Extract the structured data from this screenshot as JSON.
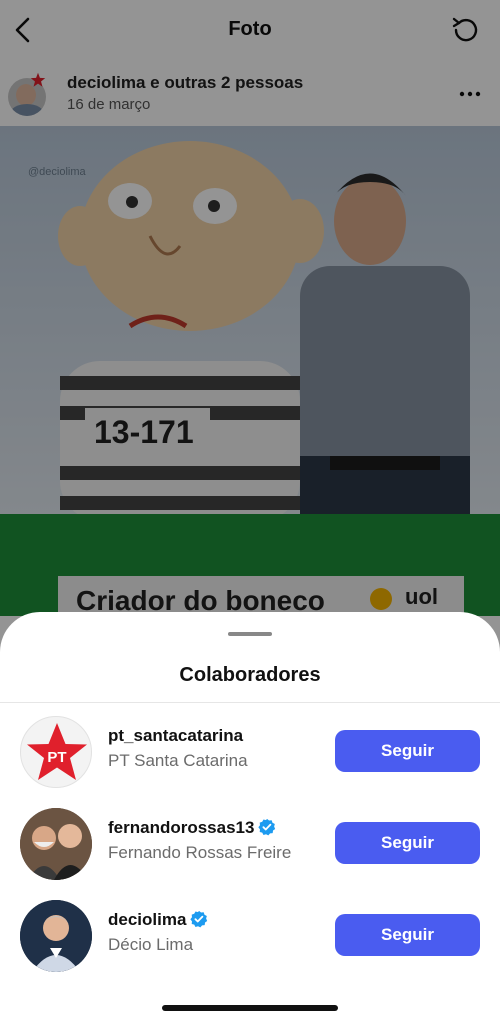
{
  "topbar": {
    "title": "Foto",
    "back_icon": "chevron-left-icon",
    "refresh_icon": "refresh-icon"
  },
  "post": {
    "author_line": "deciolima e outras 2 pessoas",
    "date": "16 de março",
    "more_icon": "more-horizontal-icon",
    "image": {
      "watermark": "@deciolima",
      "prisoner_number": "13-171",
      "caption": "Criador do boneco",
      "logo_text": "uol"
    }
  },
  "sheet": {
    "title": "Colaboradores",
    "collaborators": [
      {
        "username": "pt_santacatarina",
        "name": "PT Santa Catarina",
        "verified": false,
        "button": "Seguir",
        "avatar_text": "PT"
      },
      {
        "username": "fernandorossas13",
        "name": "Fernando Rossas Freire",
        "verified": true,
        "button": "Seguir"
      },
      {
        "username": "deciolima",
        "name": "Décio Lima",
        "verified": true,
        "button": "Seguir"
      }
    ]
  },
  "colors": {
    "follow_button": "#4a5cf0",
    "verified_badge": "#1d9bf0",
    "pt_star": "#e0202c",
    "green_band": "#1e8f3a"
  }
}
